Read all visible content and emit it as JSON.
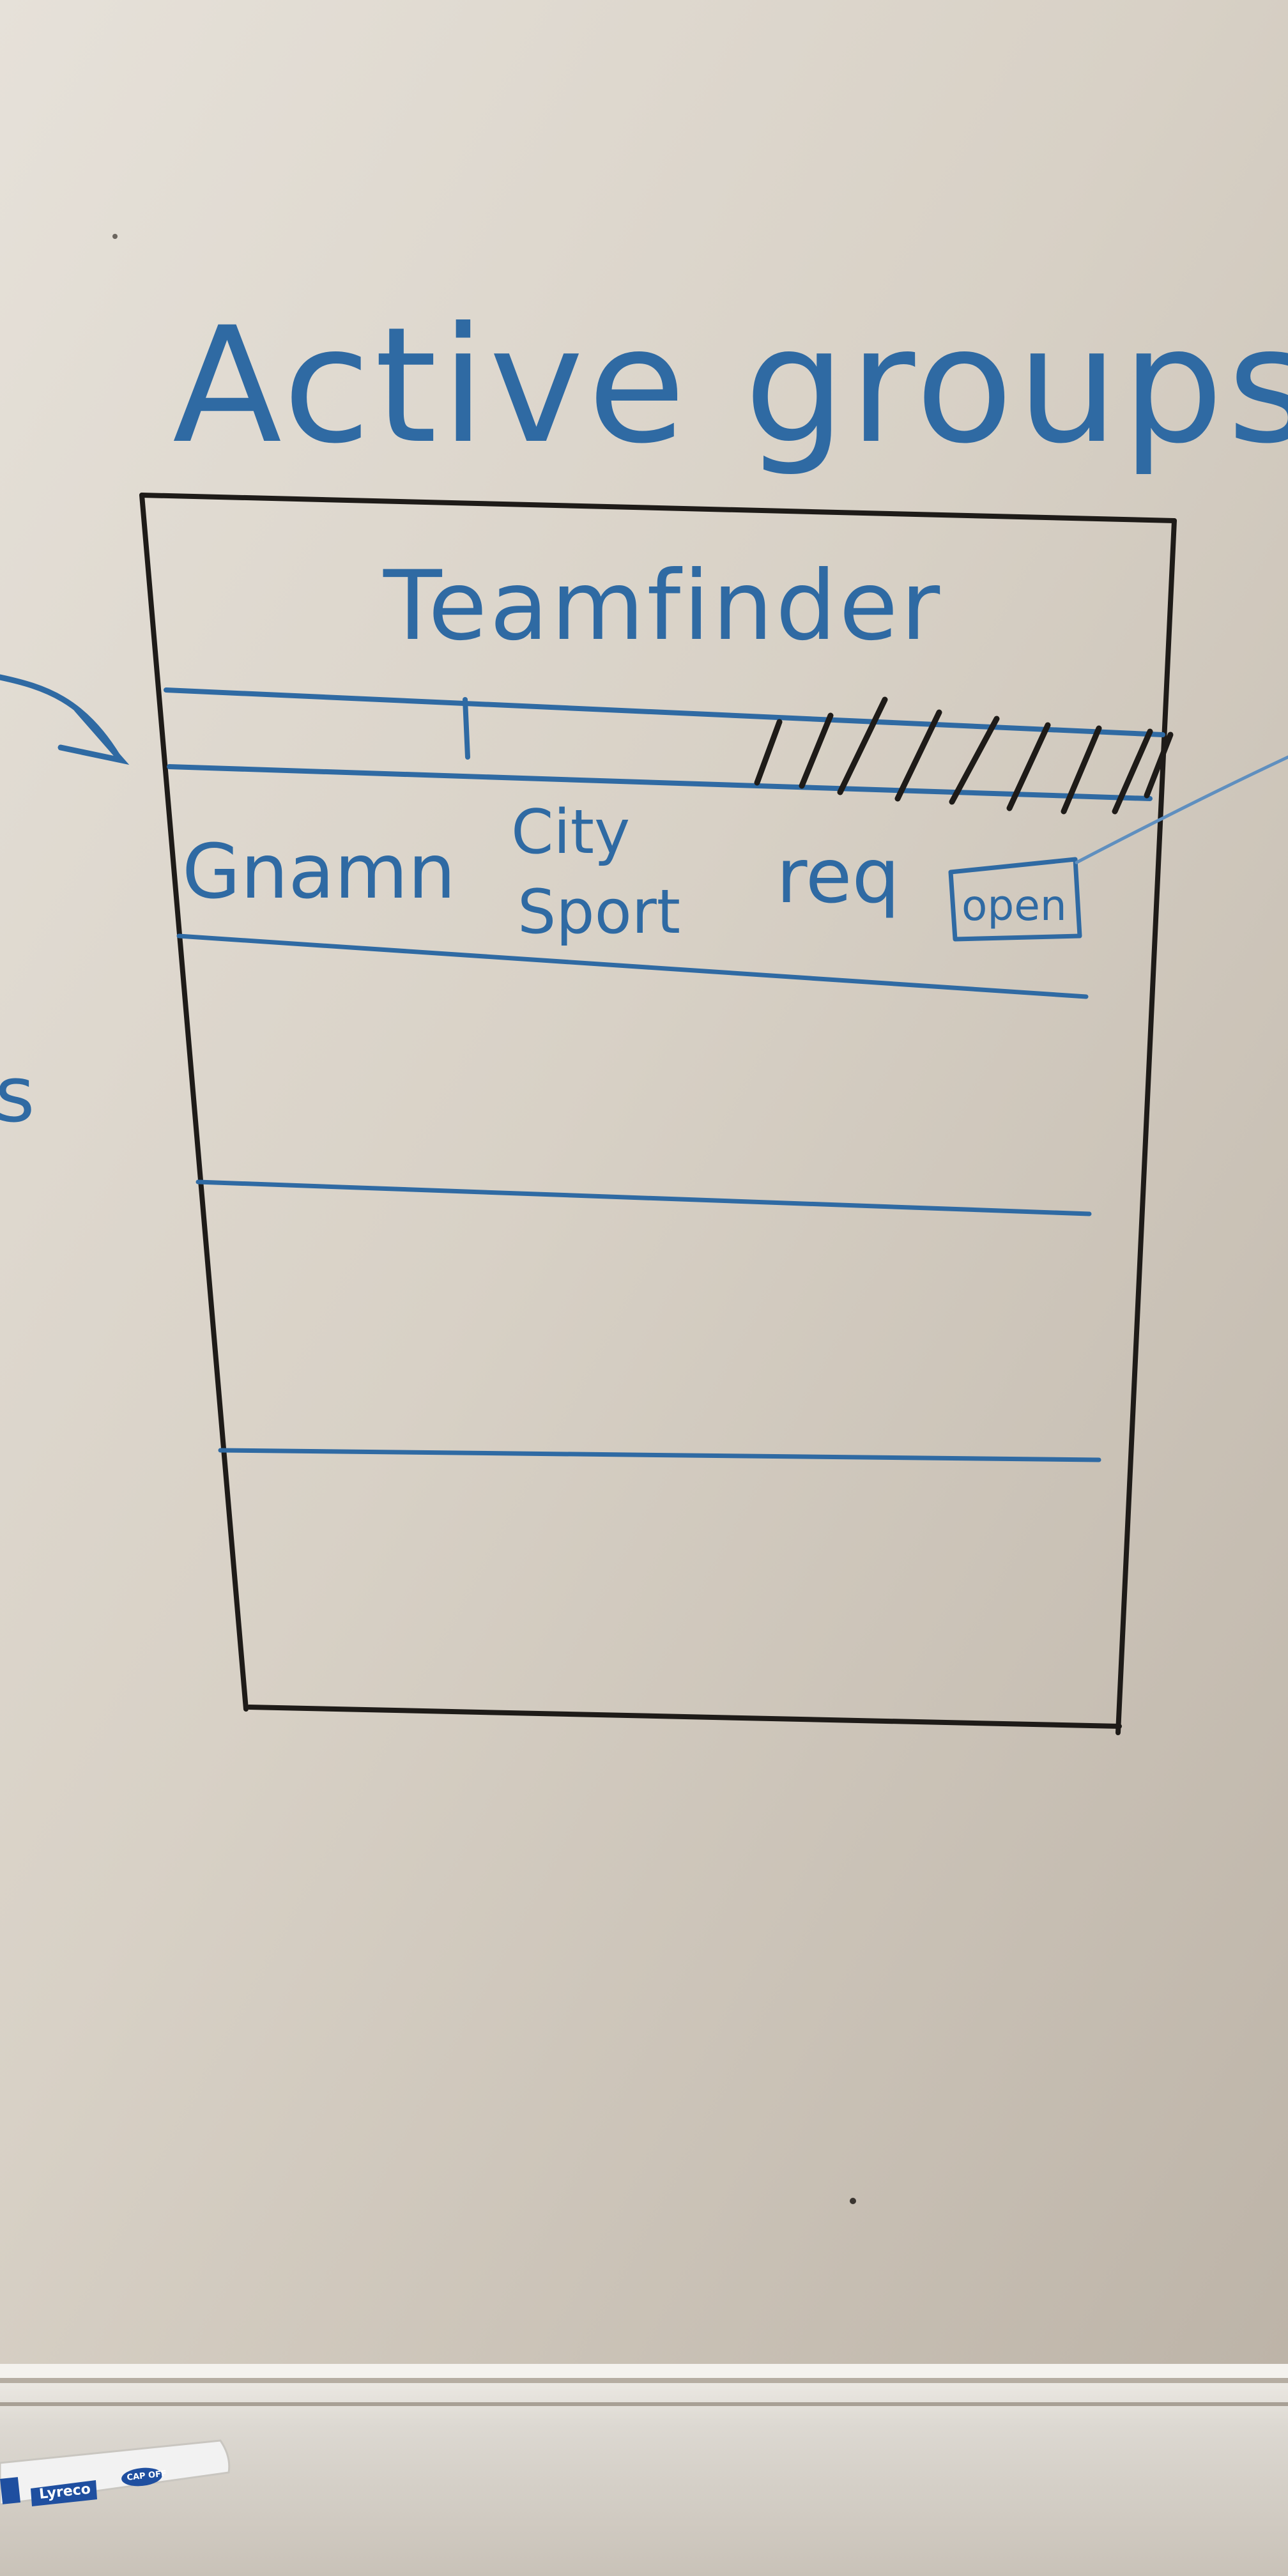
{
  "whiteboard": {
    "heading": "Active groups",
    "wireframe": {
      "app_title": "Teamfinder",
      "list_row": {
        "group_name": "Gnamn",
        "city": "City",
        "sport": "Sport",
        "requirement": "req",
        "open_button_label": "open"
      },
      "empty_row_count": 3
    },
    "left_edge_fragment": "s"
  },
  "marker": {
    "brand": "Lyreco",
    "cap_label": "CAP OFF"
  },
  "colors": {
    "board": "#d9d2c8",
    "blue_ink": "#2f6aa3",
    "black_ink": "#1e1b18",
    "tray": "#e6e2dc",
    "marker_body": "#f2f2f2",
    "marker_band": "#1f4fa0"
  },
  "icons": {
    "arrow_in": "arrow-right-icon",
    "connector_out": "connector-line-icon"
  }
}
